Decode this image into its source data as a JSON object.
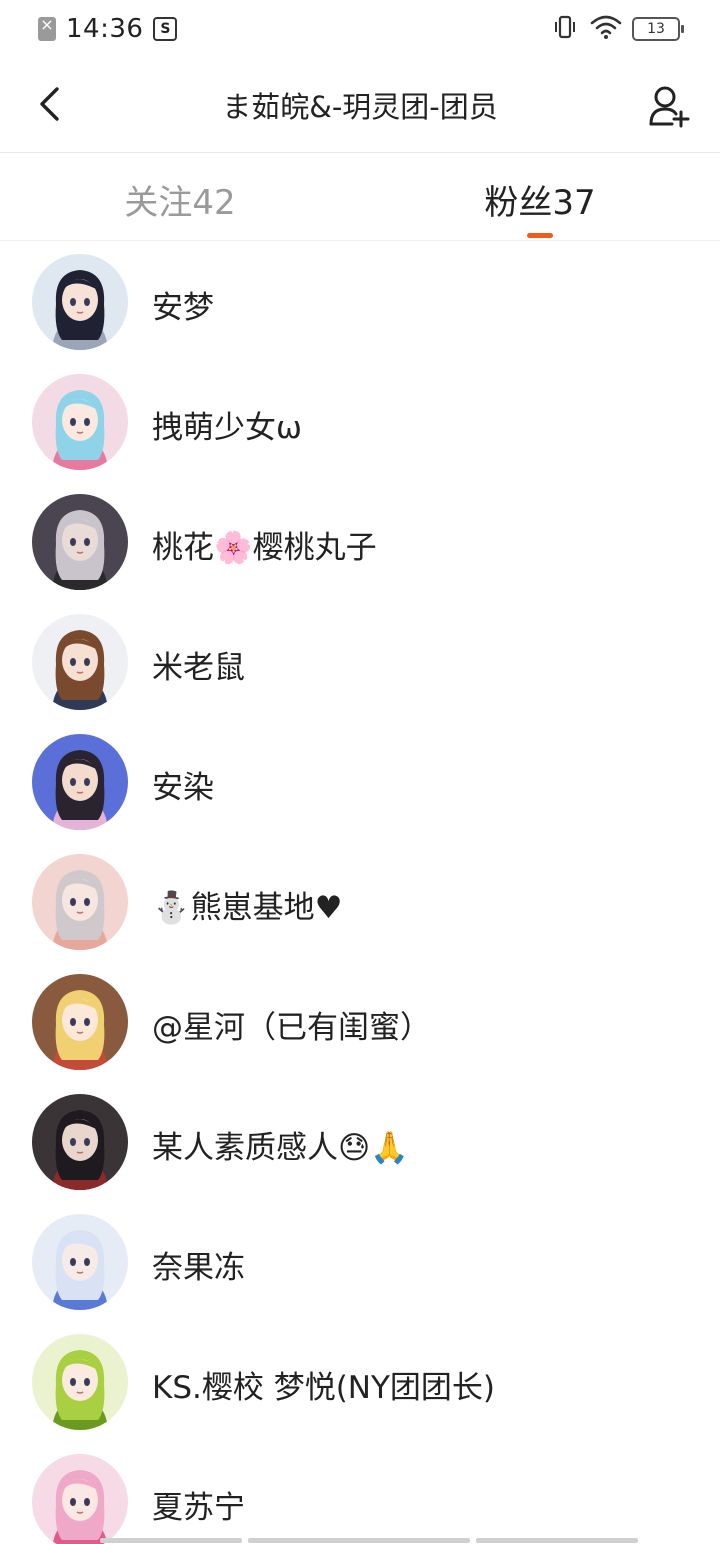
{
  "status_bar": {
    "time": "14:36",
    "battery": "13"
  },
  "header": {
    "title": "ま茹皖&-玥灵团-团员"
  },
  "tabs": [
    {
      "label": "关注42",
      "active": false
    },
    {
      "label": "粉丝37",
      "active": true
    }
  ],
  "colors": {
    "accent": "#ef5b18",
    "inactive_tab": "#9a9a9a",
    "text": "#222222"
  },
  "followers": [
    {
      "name": "安梦",
      "avatar": {
        "bg": "#dfe7f0",
        "hair": "#1e2233",
        "skin": "#f6e2d6",
        "accent": "#9aa6b8"
      }
    },
    {
      "name": "拽萌少女ω",
      "avatar": {
        "bg": "#f3dbe6",
        "hair": "#8fd3e8",
        "skin": "#fbe8e0",
        "accent": "#e87aa0"
      }
    },
    {
      "name": "桃花🌸樱桃丸子",
      "avatar": {
        "bg": "#4a4550",
        "hair": "#c9c4cc",
        "skin": "#e9dcd6",
        "accent": "#2a2a2e"
      }
    },
    {
      "name": "米老鼠",
      "avatar": {
        "bg": "#eef0f4",
        "hair": "#7a4a2e",
        "skin": "#f6e0d2",
        "accent": "#2f3a56"
      }
    },
    {
      "name": "安染",
      "avatar": {
        "bg": "#5a6fd8",
        "hair": "#2a2430",
        "skin": "#f3dccd",
        "accent": "#e6b3d8"
      }
    },
    {
      "name": "⛄熊崽基地♥",
      "avatar": {
        "bg": "#f2d4d0",
        "hair": "#cfc9cc",
        "skin": "#f7e6df",
        "accent": "#e7a89c"
      }
    },
    {
      "name": "@星河（已有闺蜜）",
      "avatar": {
        "bg": "#8a5a3e",
        "hair": "#f0d070",
        "skin": "#fbe8d8",
        "accent": "#c44a3a"
      }
    },
    {
      "name": "某人素质感人😓🙏",
      "avatar": {
        "bg": "#3a3436",
        "hair": "#1e1a20",
        "skin": "#e9d6cc",
        "accent": "#8a2a2a"
      }
    },
    {
      "name": "奈果冻",
      "avatar": {
        "bg": "#e6ecf6",
        "hair": "#d9e2f4",
        "skin": "#f6ebe6",
        "accent": "#5a7ad8"
      }
    },
    {
      "name": "KS.樱校  梦悦(NY团团长)",
      "avatar": {
        "bg": "#eaf2d0",
        "hair": "#a8d040",
        "skin": "#fbeadf",
        "accent": "#6a9a20"
      }
    },
    {
      "name": "夏苏宁",
      "avatar": {
        "bg": "#f6dbe6",
        "hair": "#f0a8c8",
        "skin": "#fbe8e4",
        "accent": "#e05a8a"
      }
    }
  ]
}
